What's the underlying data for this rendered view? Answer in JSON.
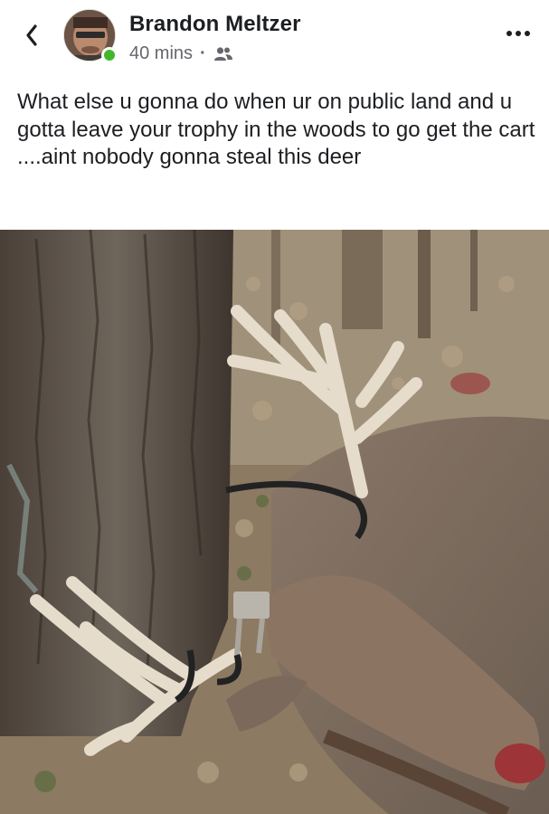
{
  "post": {
    "author": "Brandon Meltzer",
    "time": "40 mins",
    "separator": "·",
    "audience_icon": "friends-icon",
    "text": "What else u gonna do when ur on public land and u gotta leave your trophy in the woods to go get the cart ....aint nobody gonna steal this deer"
  },
  "icons": {
    "back": "chevron-left-icon",
    "more": "more-dots-icon"
  },
  "colors": {
    "online": "#42b72a",
    "meta_text": "#65676b",
    "text": "#1c1e21"
  }
}
